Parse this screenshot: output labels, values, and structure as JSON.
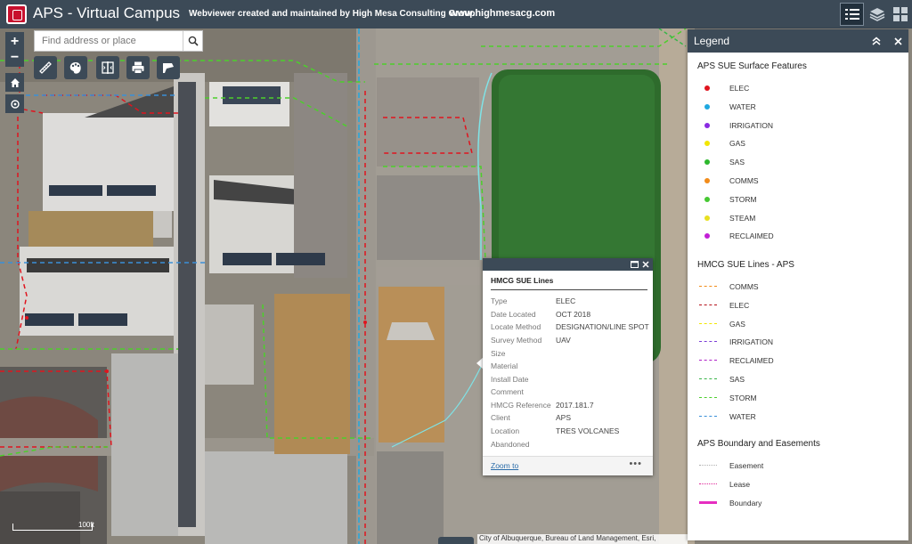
{
  "header": {
    "title": "APS - Virtual Campus",
    "subtitle": "Webviewer created and maintained by High Mesa Consulting Group",
    "website": "www.highmesacg.com",
    "icons": [
      "legend-list-icon",
      "layers-icon",
      "basemap-gallery-icon"
    ]
  },
  "map": {
    "zoom_in": "+",
    "zoom_out": "−",
    "search": {
      "placeholder": "Find address or place",
      "value": ""
    },
    "tools": [
      "measure-icon",
      "palette-icon",
      "swipe-icon",
      "print-icon",
      "draw-icon"
    ],
    "scale": "100ft",
    "attribution": "City of Albuquerque, Bureau of Land Management, Esri,"
  },
  "popup": {
    "title": "HMCG SUE Lines",
    "fields": [
      {
        "label": "Type",
        "value": "ELEC"
      },
      {
        "label": "Date Located",
        "value": "OCT 2018"
      },
      {
        "label": "Locate Method",
        "value": "DESIGNATION/LINE SPOT"
      },
      {
        "label": "Survey Method",
        "value": "UAV"
      },
      {
        "label": "Size",
        "value": ""
      },
      {
        "label": "Material",
        "value": ""
      },
      {
        "label": "Install Date",
        "value": ""
      },
      {
        "label": "Comment",
        "value": ""
      },
      {
        "label": "HMCG Reference",
        "value": "2017.181.7"
      },
      {
        "label": "Client",
        "value": "APS"
      },
      {
        "label": "Location",
        "value": "TRES VOLCANES"
      },
      {
        "label": "Abandoned",
        "value": ""
      }
    ],
    "zoom_to": "Zoom to",
    "more": "•••"
  },
  "legend": {
    "title": "Legend",
    "sections": [
      {
        "title": "APS SUE Surface Features",
        "items": [
          {
            "label": "ELEC",
            "color": "#e0141e"
          },
          {
            "label": "WATER",
            "color": "#1fa8e0"
          },
          {
            "label": "IRRIGATION",
            "color": "#8a2be2"
          },
          {
            "label": "GAS",
            "color": "#f2e600"
          },
          {
            "label": "SAS",
            "color": "#2db82d"
          },
          {
            "label": "COMMS",
            "color": "#f28c1a"
          },
          {
            "label": "STORM",
            "color": "#46c832"
          },
          {
            "label": "STEAM",
            "color": "#e8e020"
          },
          {
            "label": "RECLAIMED",
            "color": "#c21fd6"
          }
        ]
      },
      {
        "title": "HMCG SUE Lines - APS",
        "items": [
          {
            "label": "COMMS",
            "color": "#f28c1a"
          },
          {
            "label": "ELEC",
            "color": "#b5121b"
          },
          {
            "label": "GAS",
            "color": "#f2e600"
          },
          {
            "label": "IRRIGATION",
            "color": "#7a3cd6"
          },
          {
            "label": "RECLAIMED",
            "color": "#b01fc8"
          },
          {
            "label": "SAS",
            "color": "#39b54a"
          },
          {
            "label": "STORM",
            "color": "#4ccf2b"
          },
          {
            "label": "WATER",
            "color": "#3a8fd8"
          }
        ]
      },
      {
        "title": "APS Boundary and Easements",
        "items": [
          {
            "label": "Easement",
            "color": "#b0b0b0"
          },
          {
            "label": "Lease",
            "color": "#e0289a"
          },
          {
            "label": "Boundary",
            "color": "#e62ec0"
          }
        ]
      }
    ]
  }
}
